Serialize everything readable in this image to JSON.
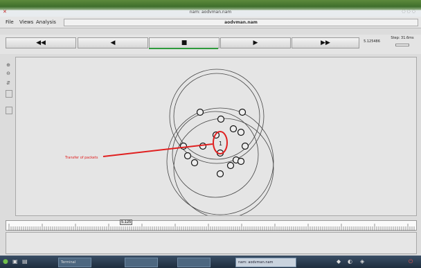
{
  "window": {
    "title": "nam: aodvman.nam"
  },
  "menu": {
    "items": [
      "File",
      "Views",
      "Analysis"
    ],
    "filename": "aodvman.nam"
  },
  "controls": {
    "rewind": "◀◀",
    "back": "◀",
    "stop": "■",
    "play": "▶",
    "forward": "▶▶",
    "time": "5.125486",
    "step": "Step: 31.6ms"
  },
  "canvas": {
    "annotation": "Transfer of packets",
    "highlight_label": "1",
    "accent_color": "#e02020"
  },
  "timeline": {
    "marker": "5.125"
  },
  "taskbar": {
    "windows": [
      "Terminal",
      "",
      "",
      "nam: aodvman.nam"
    ]
  }
}
